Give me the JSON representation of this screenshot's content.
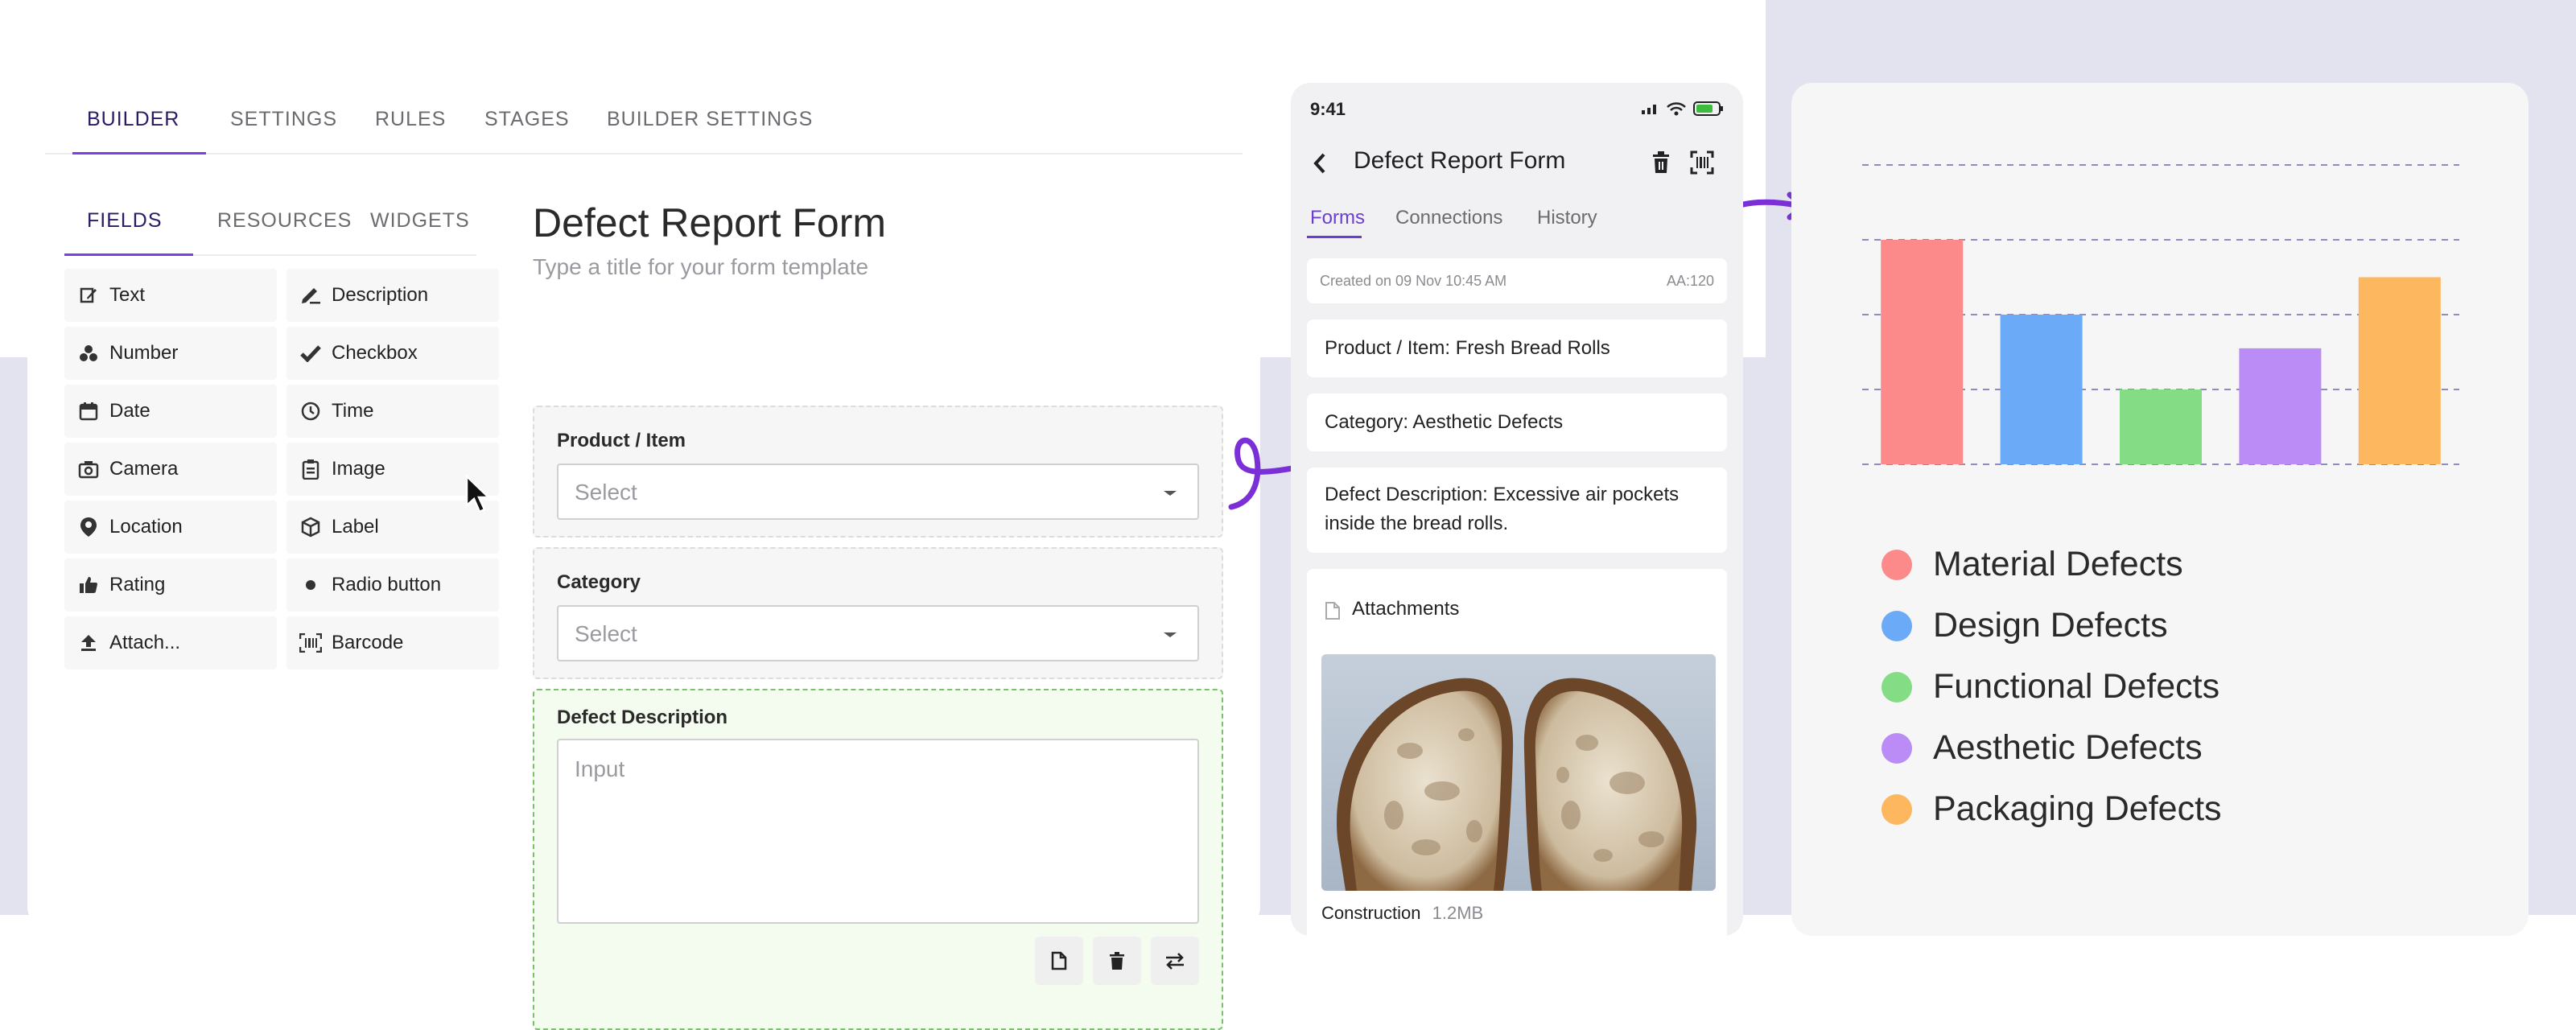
{
  "builder": {
    "top_tabs": [
      "BUILDER",
      "SETTINGS",
      "RULES",
      "STAGES",
      "BUILDER SETTINGS"
    ],
    "sub_tabs": [
      "FIELDS",
      "RESOURCES",
      "WIDGETS"
    ],
    "fields_left": [
      "Text",
      "Number",
      "Date",
      "Camera",
      "Location",
      "Rating",
      "Attach..."
    ],
    "fields_right": [
      "Description",
      "Checkbox",
      "Time",
      "Image",
      "Label",
      "Radio button",
      "Barcode"
    ],
    "form": {
      "title": "Defect Report Form",
      "subtitle": "Type a title for your form template",
      "product_label": "Product / Item",
      "product_placeholder": "Select",
      "category_label": "Category",
      "category_placeholder": "Select",
      "description_label": "Defect Description",
      "description_placeholder": "Input"
    }
  },
  "phone": {
    "time": "9:41",
    "title": "Defect Report Form",
    "tabs": [
      "Forms",
      "Connections",
      "History"
    ],
    "created": "Created on 09 Nov 10:45 AM",
    "code": "AA:120",
    "product": "Product / Item: Fresh Bread Rolls",
    "category": "Category: Aesthetic Defects",
    "description": "Defect Description: Excessive air pockets inside the bread rolls.",
    "attachments_label": "Attachments",
    "attachment_name": "Construction",
    "attachment_size": "1.2MB"
  },
  "chart_data": {
    "type": "bar",
    "categories": [
      "Material Defects",
      "Design Defects",
      "Functional Defects",
      "Aesthetic Defects",
      "Packaging Defects"
    ],
    "values": [
      3,
      2,
      1,
      1.55,
      2.5
    ],
    "ylim": [
      0,
      4
    ],
    "grid": true,
    "legend_position": "bottom-left",
    "colors": [
      "#fd8a8a",
      "#6aaaf7",
      "#84dc84",
      "#bb8cf6",
      "#fdb75e"
    ],
    "title": "",
    "xlabel": "",
    "ylabel": ""
  },
  "colors": {
    "accent": "#7b3fe4",
    "background_lavender": "#e3e3f0"
  }
}
